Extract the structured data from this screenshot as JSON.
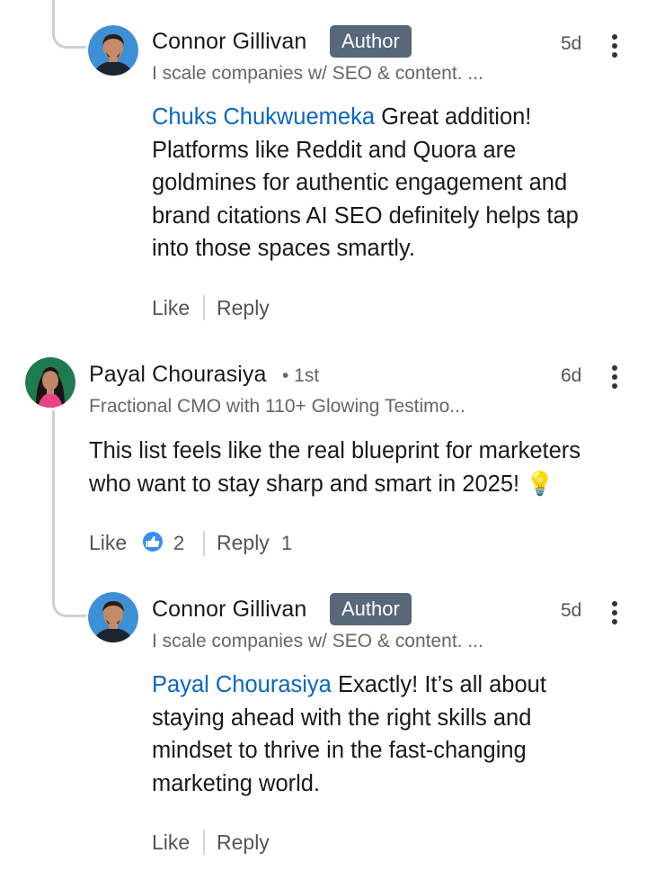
{
  "comments": [
    {
      "name": "Connor Gillivan",
      "badge": "Author",
      "headline": "I scale companies w/ SEO & content. ...",
      "time": "5d",
      "mention": "Chuks Chukwuemeka",
      "text_lines": [
        "Great addition!",
        "Platforms like Reddit and Quora are",
        "goldmines for authentic engagement and",
        "brand citations AI SEO definitely helps tap",
        "into those spaces smartly."
      ],
      "like_label": "Like",
      "reply_label": "Reply"
    },
    {
      "name": "Payal Chourasiya",
      "degree": "• 1st",
      "headline": "Fractional CMO with 110+ Glowing Testimo...",
      "time": "6d",
      "text_lines": [
        "This list feels like the real blueprint for marketers",
        "who want to stay sharp and smart in 2025! 💡"
      ],
      "like_label": "Like",
      "like_count": "2",
      "reply_label": "Reply",
      "reply_count": "1"
    },
    {
      "name": "Connor Gillivan",
      "badge": "Author",
      "headline": "I scale companies w/ SEO & content. ...",
      "time": "5d",
      "mention": "Payal Chourasiya",
      "text_lines": [
        "Exactly! It’s all about",
        "staying ahead with the right skills and",
        "mindset to thrive in the fast-changing",
        "marketing world."
      ],
      "like_label": "Like",
      "reply_label": "Reply"
    }
  ],
  "icons": {
    "more": "more-vertical-icon",
    "reaction": "thumbs-up-reaction-icon"
  },
  "colors": {
    "mention": "#0a66c2",
    "author_badge": "#56687a",
    "reaction": "#378fe9"
  }
}
